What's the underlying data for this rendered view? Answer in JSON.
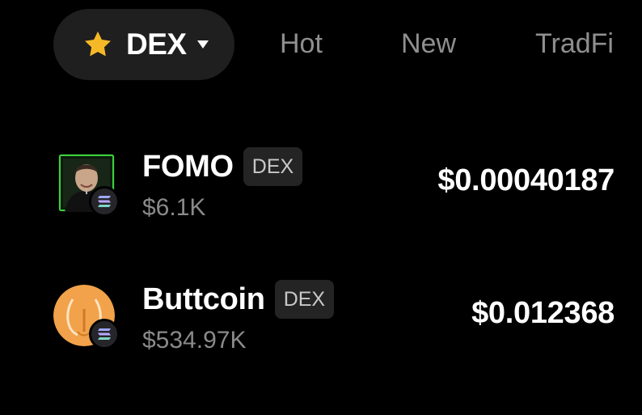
{
  "tabs": {
    "active": {
      "label": "DEX",
      "icon": "star-icon",
      "star_color": "#f5b927"
    },
    "hot": "Hot",
    "new": "New",
    "tradfi": "TradFi"
  },
  "tokens": [
    {
      "name": "FOMO",
      "tag": "DEX",
      "market_cap": "$6.1K",
      "price": "$0.00040187",
      "avatar": "person-portrait",
      "chain_icon": "solana-icon"
    },
    {
      "name": "Buttcoin",
      "tag": "DEX",
      "market_cap": "$534.97K",
      "price": "$0.012368",
      "avatar": "buttcoin-logo",
      "chain_icon": "solana-icon",
      "avatar_color": "#f2a24a"
    }
  ],
  "colors": {
    "background": "#000000",
    "pill": "#1f1f1f",
    "muted_text": "#8f8f8f"
  }
}
